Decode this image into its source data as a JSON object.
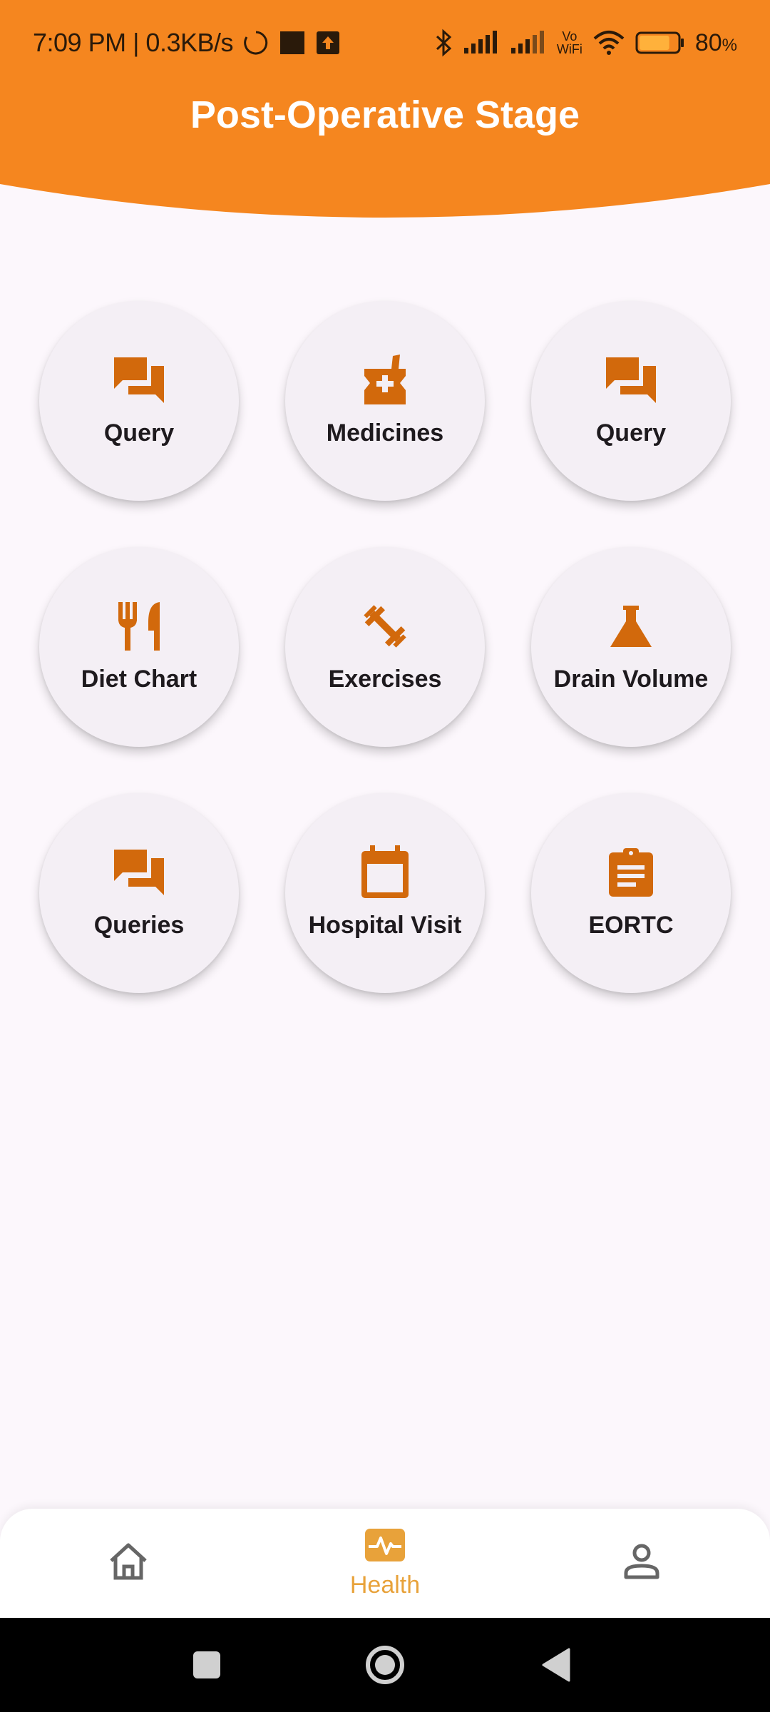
{
  "status_bar": {
    "time": "7:09 PM | 0.3KB/s",
    "battery_percent": "80",
    "battery_percent_unit": "%",
    "vowifi_line1": "Vo",
    "vowifi_line2": "WiFi",
    "battery_level": 0.8,
    "icons": [
      "loading-circle-icon",
      "app-notification-icon",
      "upload-icon",
      "bluetooth-icon",
      "signal-icon",
      "signal-icon",
      "vowifi-icon",
      "wifi-icon",
      "battery-icon"
    ]
  },
  "header": {
    "title": "Post-Operative Stage",
    "color": "#f5861f"
  },
  "accent_color": "#d2690c",
  "grid": [
    {
      "label": "Query",
      "icon": "forum-icon"
    },
    {
      "label": "Medicines",
      "icon": "medication-icon"
    },
    {
      "label": "Query",
      "icon": "forum-icon"
    },
    {
      "label": "Diet Chart",
      "icon": "restaurant-icon"
    },
    {
      "label": "Exercises",
      "icon": "fitness-icon"
    },
    {
      "label": "Drain Volume",
      "icon": "flask-icon"
    },
    {
      "label": "Queries",
      "icon": "forum-icon"
    },
    {
      "label": "Hospital Visit",
      "icon": "calendar-icon"
    },
    {
      "label": "EORTC",
      "icon": "assignment-icon"
    }
  ],
  "bottom_nav": {
    "active_color": "#e8a23a",
    "items": [
      {
        "label": "",
        "icon": "home-icon",
        "active": false
      },
      {
        "label": "Health",
        "icon": "health-icon",
        "active": true
      },
      {
        "label": "",
        "icon": "person-icon",
        "active": false
      }
    ]
  },
  "system_nav": {
    "icons": [
      "recents-icon",
      "home-circle-icon",
      "back-icon"
    ]
  }
}
